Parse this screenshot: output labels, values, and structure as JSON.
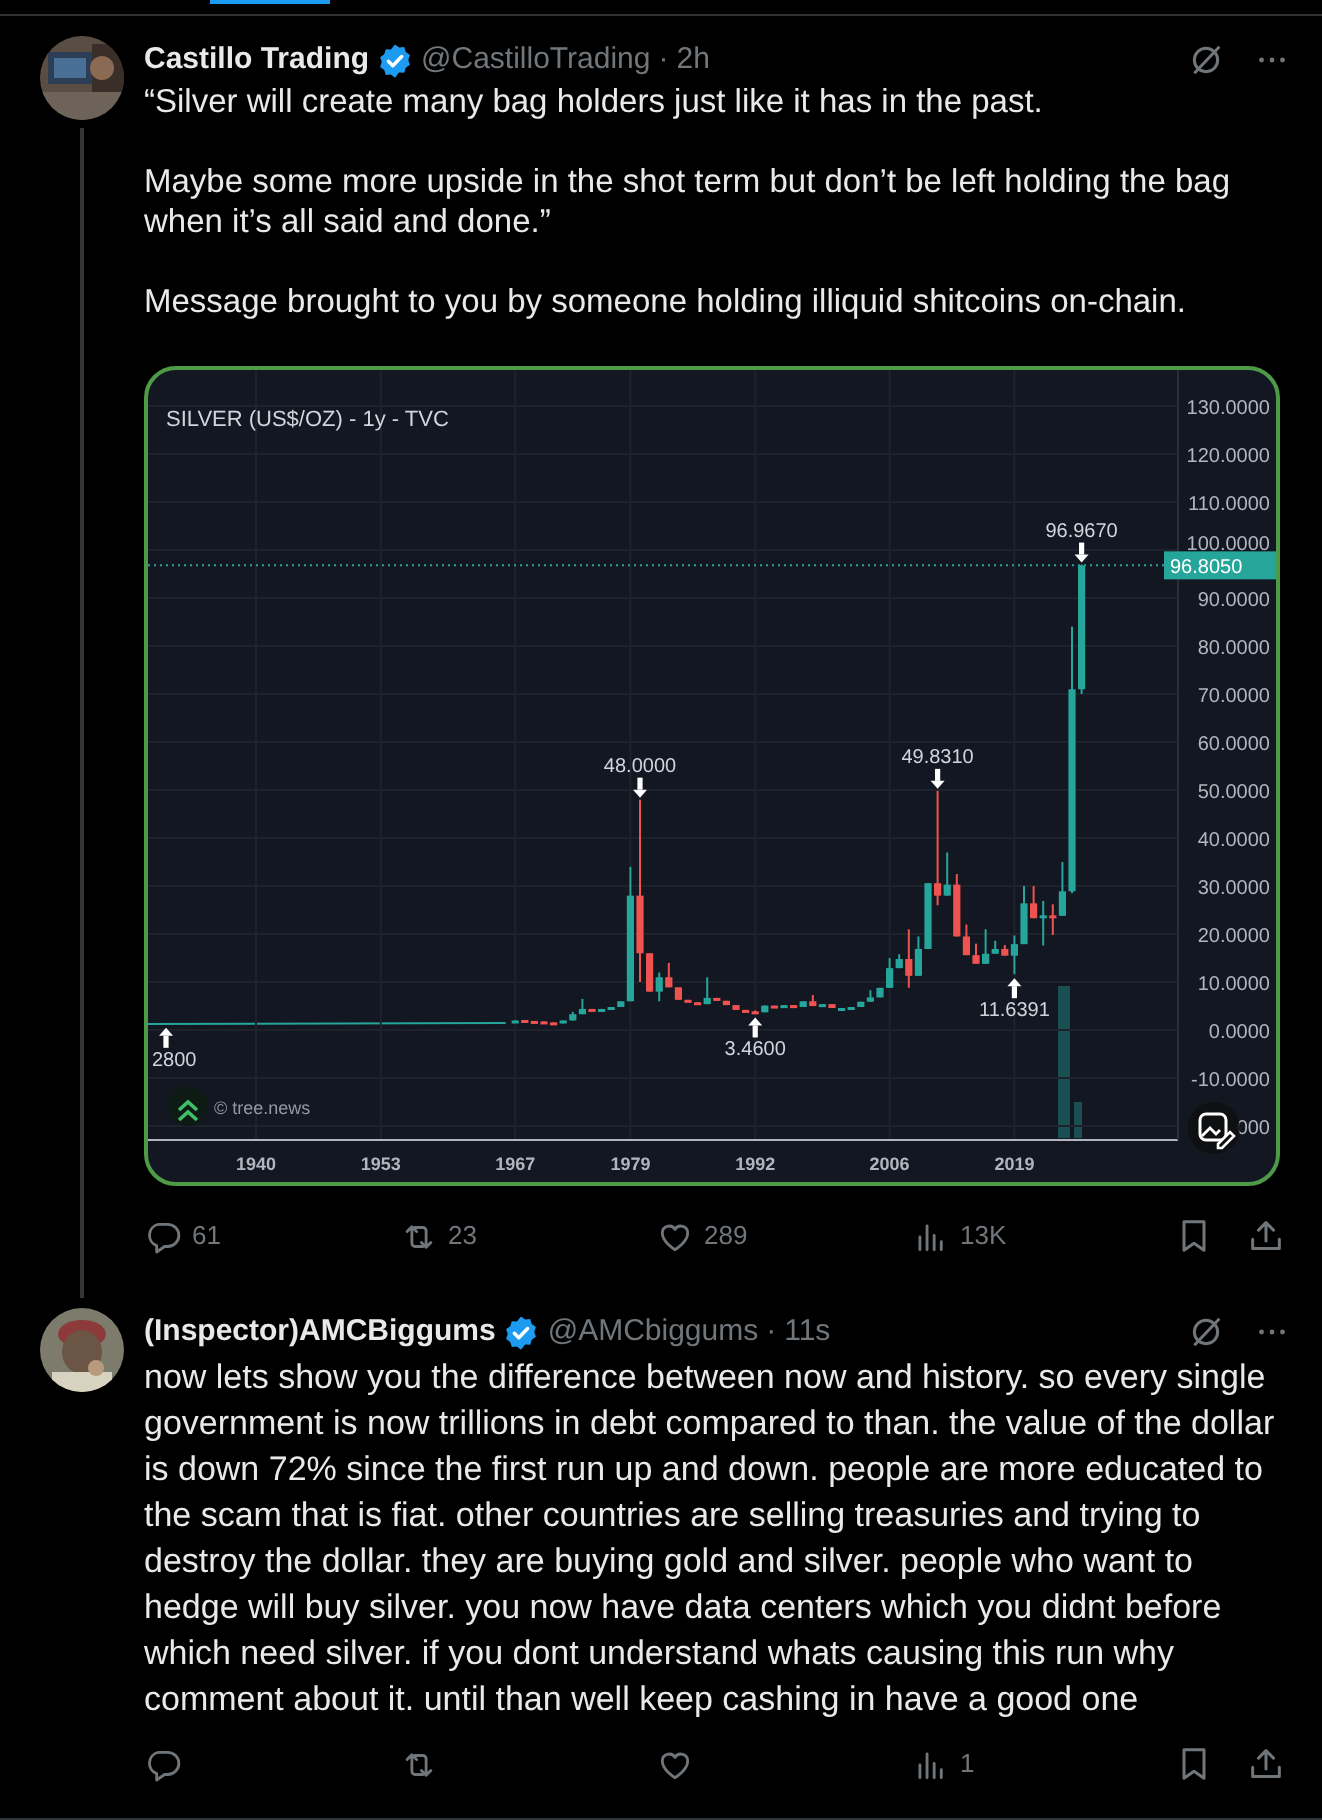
{
  "tweets": [
    {
      "name": "Castillo Trading",
      "verified": true,
      "handle": "@CastilloTrading",
      "separator": "·",
      "time": "2h",
      "thread_line": true,
      "paragraphs": [
        "“Silver will create many bag holders just like it has in the past.",
        "Maybe some more upside in the shot term but don’t be left holding the bag when it’s all said and done.”",
        "Message brought to you by someone holding illiquid shitcoins on-chain."
      ],
      "chart": {
        "source": "© tree.news",
        "covered_label": "000",
        "chart_data": {
          "type": "candlestick",
          "title": "SILVER (US$/OZ) - 1y - TVC",
          "xlim": [
            1928.75,
            2036.04
          ],
          "ylim": [
            -22.9,
            137.5
          ],
          "grid": true,
          "ref_lines": [
            {
              "axis": "y",
              "value": 96.805,
              "label": "96.8050"
            }
          ],
          "x": [
            1967,
            1968,
            1969,
            1970,
            1971,
            1972,
            1973,
            1974,
            1975,
            1976,
            1977,
            1978,
            1979,
            1980,
            1981,
            1982,
            1983,
            1984,
            1985,
            1986,
            1987,
            1988,
            1989,
            1990,
            1991,
            1992,
            1993,
            1994,
            1995,
            1996,
            1997,
            1998,
            1999,
            2000,
            2001,
            2002,
            2003,
            2004,
            2005,
            2006,
            2007,
            2008,
            2009,
            2010,
            2011,
            2012,
            2013,
            2014,
            2015,
            2016,
            2017,
            2018,
            2019,
            2020,
            2021,
            2022,
            2023,
            2024,
            2025,
            2026
          ],
          "ohlc": [
            [
              1.5,
              2.0,
              1.5,
              2.0
            ],
            [
              2.1,
              2.1,
              1.9,
              1.9
            ],
            [
              1.9,
              1.9,
              1.8,
              1.8
            ],
            [
              1.8,
              1.8,
              1.6,
              1.6
            ],
            [
              1.6,
              1.6,
              1.4,
              1.4
            ],
            [
              1.4,
              2.0,
              1.4,
              2.0
            ],
            [
              2.0,
              3.8,
              2.0,
              3.3
            ],
            [
              3.3,
              6.5,
              3.3,
              4.4
            ],
            [
              4.4,
              4.4,
              4.2,
              4.2
            ],
            [
              4.2,
              4.4,
              4.2,
              4.4
            ],
            [
              4.4,
              4.8,
              4.4,
              4.8
            ],
            [
              4.8,
              6.0,
              4.8,
              6.0
            ],
            [
              6.0,
              34,
              6.0,
              28
            ],
            [
              28,
              48,
              10,
              16
            ],
            [
              16,
              16,
              8,
              8
            ],
            [
              8,
              12,
              6,
              11
            ],
            [
              11,
              14,
              8.9,
              8.9
            ],
            [
              8.9,
              8.9,
              6.3,
              6.3
            ],
            [
              6.3,
              6.3,
              5.8,
              5.8
            ],
            [
              5.8,
              5.8,
              5.4,
              5.4
            ],
            [
              5.4,
              11,
              5.4,
              6.7
            ],
            [
              6.7,
              6.7,
              6.1,
              6.1
            ],
            [
              6.1,
              6.1,
              5.2,
              5.2
            ],
            [
              5.2,
              5.2,
              4.2,
              4.2
            ],
            [
              4.2,
              4.2,
              3.9,
              3.9
            ],
            [
              3.9,
              4.1,
              3.46,
              3.7
            ],
            [
              3.7,
              5.1,
              3.7,
              5.1
            ],
            [
              5.1,
              5.1,
              4.9,
              4.9
            ],
            [
              4.9,
              5.2,
              4.9,
              5.2
            ],
            [
              5.2,
              5.2,
              4.8,
              4.8
            ],
            [
              4.8,
              6.0,
              4.8,
              6.0
            ],
            [
              6.0,
              7.3,
              5.0,
              5.0
            ],
            [
              5.0,
              5.4,
              5.0,
              5.4
            ],
            [
              5.4,
              5.4,
              4.6,
              4.6
            ],
            [
              4.6,
              4.6,
              4.6,
              4.6
            ],
            [
              4.6,
              4.8,
              4.6,
              4.8
            ],
            [
              4.8,
              5.9,
              4.8,
              5.9
            ],
            [
              5.9,
              8.3,
              5.9,
              6.8
            ],
            [
              6.8,
              8.8,
              6.8,
              8.8
            ],
            [
              8.8,
              15,
              8.8,
              12.9
            ],
            [
              12.9,
              15.8,
              12.9,
              14.8
            ],
            [
              14.8,
              21,
              8.8,
              11.3
            ],
            [
              11.3,
              19.5,
              11.3,
              16.9
            ],
            [
              16.9,
              30.6,
              16.9,
              30.6
            ],
            [
              30.6,
              49.83,
              26,
              28
            ],
            [
              28,
              37,
              28,
              30.3
            ],
            [
              30.3,
              32.5,
              19.5,
              19.5
            ],
            [
              19.5,
              22,
              15.6,
              15.6
            ],
            [
              15.6,
              18,
              13.8,
              13.8
            ],
            [
              13.8,
              21,
              13.8,
              15.9
            ],
            [
              15.9,
              18.6,
              15.9,
              16.9
            ],
            [
              16.9,
              17.7,
              15.5,
              15.5
            ],
            [
              15.5,
              19.7,
              11.6391,
              17.9
            ],
            [
              17.9,
              30,
              17.9,
              26.4
            ],
            [
              26.4,
              30,
              23.3,
              23.3
            ],
            [
              23.3,
              26.9,
              17.6,
              23.9
            ],
            [
              23.9,
              26.2,
              19.8,
              23.8
            ],
            [
              23.8,
              35,
              23.8,
              28.9
            ],
            [
              28.9,
              84,
              28.5,
              71
            ],
            [
              71,
              96.967,
              70,
              96.805
            ]
          ],
          "yticks": [
            {
              "value": 130,
              "label": "130.0000"
            },
            {
              "value": 120,
              "label": "120.0000"
            },
            {
              "value": 110,
              "label": "110.0000"
            },
            {
              "value": 100,
              "label": "100.0000"
            },
            {
              "value": 90,
              "label": "90.0000"
            },
            {
              "value": 80,
              "label": "80.0000"
            },
            {
              "value": 70,
              "label": "70.0000"
            },
            {
              "value": 60,
              "label": "60.0000"
            },
            {
              "value": 50,
              "label": "50.0000"
            },
            {
              "value": 40,
              "label": "40.0000"
            },
            {
              "value": 30,
              "label": "30.0000"
            },
            {
              "value": 20,
              "label": "20.0000"
            },
            {
              "value": 10,
              "label": "10.0000"
            },
            {
              "value": 0,
              "label": "0.0000"
            },
            {
              "value": -10,
              "label": "-10.0000"
            }
          ],
          "xticks": [
            1940,
            1953,
            1967,
            1979,
            1992,
            2006,
            2019
          ],
          "annotations": [
            "2800",
            {
              "x": 1980,
              "y": 48,
              "text": "48.0000"
            },
            {
              "x": 1992,
              "y": 3.46,
              "text": "3.4600"
            },
            {
              "x": 2011,
              "y": 49.83,
              "text": "49.8310"
            },
            {
              "x": 2019,
              "y": 11.6391,
              "text": "11.6391"
            },
            {
              "x": 2026,
              "y": 96.967,
              "text": "96.9670"
            }
          ]
        }
      },
      "stats": [
        {
          "kind": "reply",
          "count": "61"
        },
        {
          "kind": "repost",
          "count": "23"
        },
        {
          "kind": "like",
          "count": "289"
        },
        {
          "kind": "views",
          "count": "13K"
        }
      ]
    },
    {
      "name": "(Inspector)AMCBiggums",
      "verified": true,
      "handle": "@AMCbiggums",
      "separator": "·",
      "time": "11s",
      "thread_line": false,
      "paragraphs": [
        "now lets show you the difference between now and history. so every single government is now trillions in debt compared to than. the value of the dollar is down 72% since the first run up and down. people are more educated to the scam that is fiat. other countries are selling treasuries and trying to destroy the dollar. they are buying gold and silver. people who want to hedge will buy silver. you now have data centers which you didnt before which need silver. if you dont understand whats causing this run why comment about it. until than well keep cashing in have a good one"
      ],
      "stats": [
        {
          "kind": "reply"
        },
        {
          "kind": "repost"
        },
        {
          "kind": "like"
        },
        {
          "kind": "views",
          "count": "1"
        }
      ]
    }
  ]
}
